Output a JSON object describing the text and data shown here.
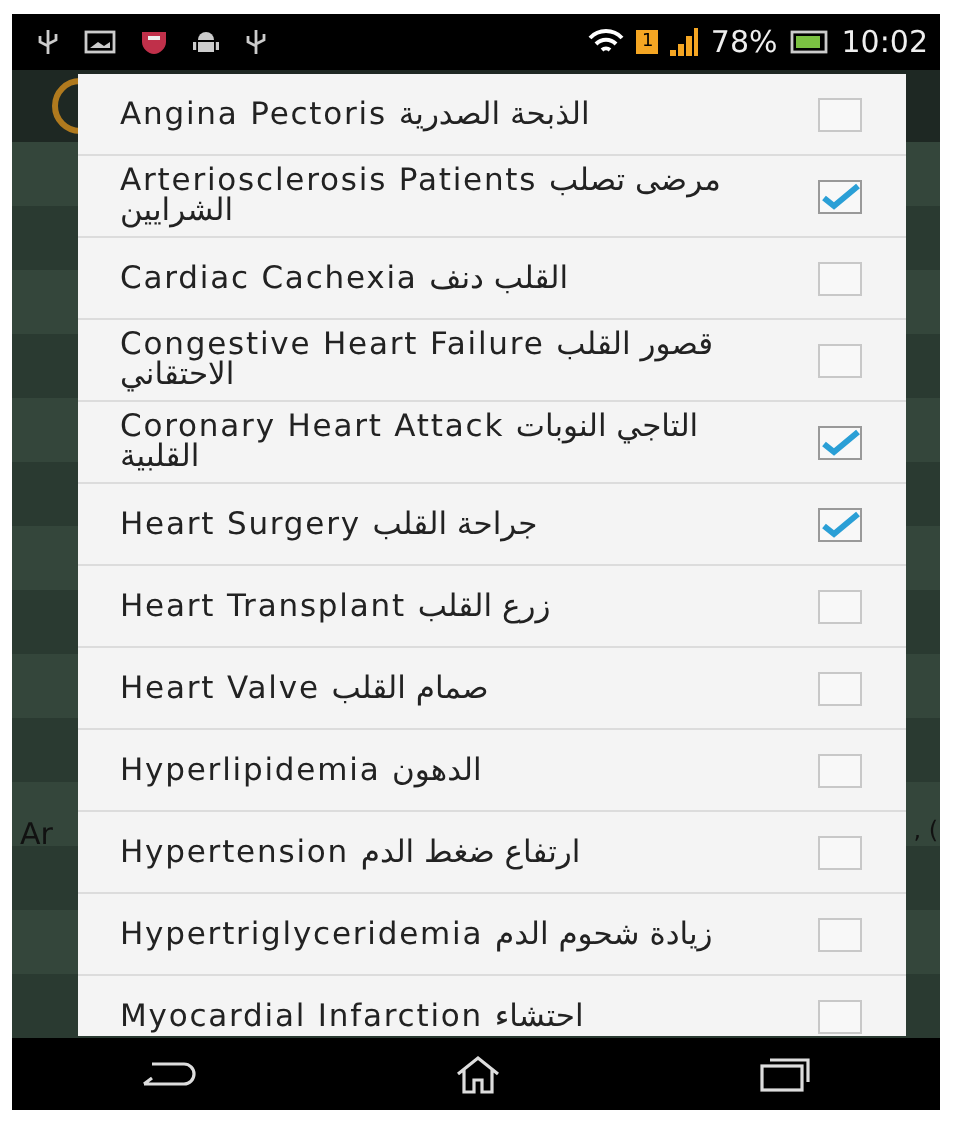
{
  "status_bar": {
    "sim": "1",
    "battery": "78%",
    "time": "10:02"
  },
  "background": {
    "left_text": "Ar",
    "right_text": ", ("
  },
  "dialog": {
    "items": [
      {
        "label": "Angina Pectoris الذبحة الصدرية",
        "checked": false
      },
      {
        "label": "Arteriosclerosis Patients مرضى تصلب الشرايين",
        "checked": true
      },
      {
        "label": "Cardiac Cachexia القلب دنف",
        "checked": false
      },
      {
        "label": "Congestive Heart Failure قصور القلب الاحتقاني",
        "checked": false
      },
      {
        "label": "Coronary Heart Attack التاجي النوبات القلبية",
        "checked": true
      },
      {
        "label": "Heart Surgery جراحة القلب",
        "checked": true
      },
      {
        "label": "Heart Transplant زرع القلب",
        "checked": false
      },
      {
        "label": "Heart Valve صمام القلب",
        "checked": false
      },
      {
        "label": "Hyperlipidemia الدهون",
        "checked": false
      },
      {
        "label": "Hypertension ارتفاع ضغط الدم",
        "checked": false
      },
      {
        "label": "Hypertriglyceridemia زيادة شحوم الدم",
        "checked": false
      },
      {
        "label": "Myocardial Infarction احتشاء",
        "checked": false
      }
    ]
  }
}
